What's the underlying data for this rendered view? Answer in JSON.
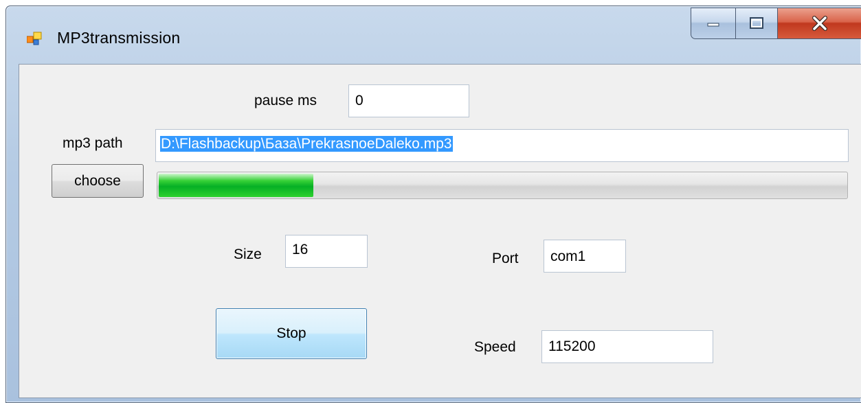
{
  "window": {
    "title": "MP3transmission",
    "icon": "winforms-app-icon",
    "controls": [
      "minimize-icon",
      "maximize-icon",
      "close-icon"
    ]
  },
  "form": {
    "pause": {
      "label": "pause ms",
      "value": "0"
    },
    "mp3_path": {
      "label": "mp3 path",
      "value": "D:\\Flashbackup\\База\\PrekrasnoeDaleko.mp3"
    },
    "choose_button": "choose",
    "progress": {
      "fraction": 0.225,
      "color": "#06b025"
    },
    "size": {
      "label": "Size",
      "value": "16"
    },
    "port": {
      "label": "Port",
      "value": "com1"
    },
    "speed": {
      "label": "Speed",
      "value": "115200"
    },
    "stop_button": "Stop"
  }
}
